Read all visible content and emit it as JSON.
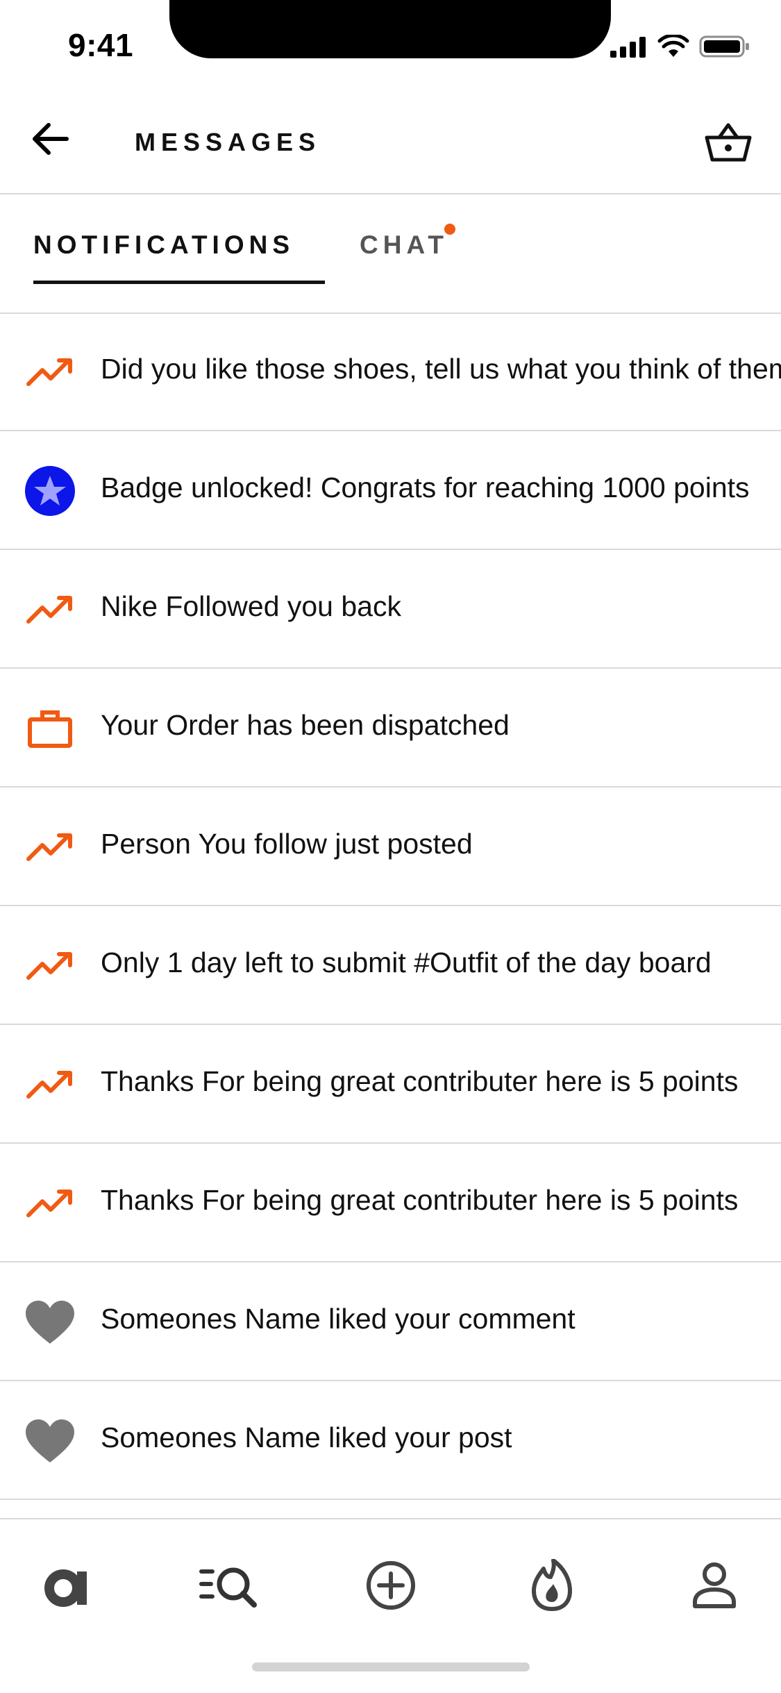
{
  "status_bar": {
    "time": "9:41"
  },
  "header": {
    "title": "MESSAGES"
  },
  "tabs": [
    {
      "label": "NOTIFICATIONS",
      "active": true
    },
    {
      "label": "CHAT",
      "active": false,
      "has_unread_dot": true
    }
  ],
  "colors": {
    "accent": "#f05a12",
    "badge_blue": "#0c16e8",
    "heart_gray": "#777777",
    "divider": "#d9d9d9"
  },
  "notifications": [
    {
      "icon": "trend-up-icon",
      "text": "Did you like those shoes, tell us what you think of them"
    },
    {
      "icon": "star-badge-icon",
      "text": "Badge unlocked! Congrats for reaching 1000 points"
    },
    {
      "icon": "trend-up-icon",
      "text": "Nike Followed you back"
    },
    {
      "icon": "briefcase-icon",
      "text": "Your Order has been dispatched"
    },
    {
      "icon": "trend-up-icon",
      "text": "Person You follow just posted"
    },
    {
      "icon": "trend-up-icon",
      "text": "Only 1 day left to submit #Outfit of the day board"
    },
    {
      "icon": "trend-up-icon",
      "text": "Thanks For being great contributer here is 5 points"
    },
    {
      "icon": "trend-up-icon",
      "text": "Thanks For being great contributer here is 5 points"
    },
    {
      "icon": "heart-icon",
      "text": "Someones Name liked your comment"
    },
    {
      "icon": "heart-icon",
      "text": "Someones Name liked your post"
    }
  ],
  "bottom_nav": [
    {
      "icon": "home-logo-icon"
    },
    {
      "icon": "search-list-icon"
    },
    {
      "icon": "add-circle-icon"
    },
    {
      "icon": "trending-flame-icon"
    },
    {
      "icon": "profile-icon"
    }
  ]
}
